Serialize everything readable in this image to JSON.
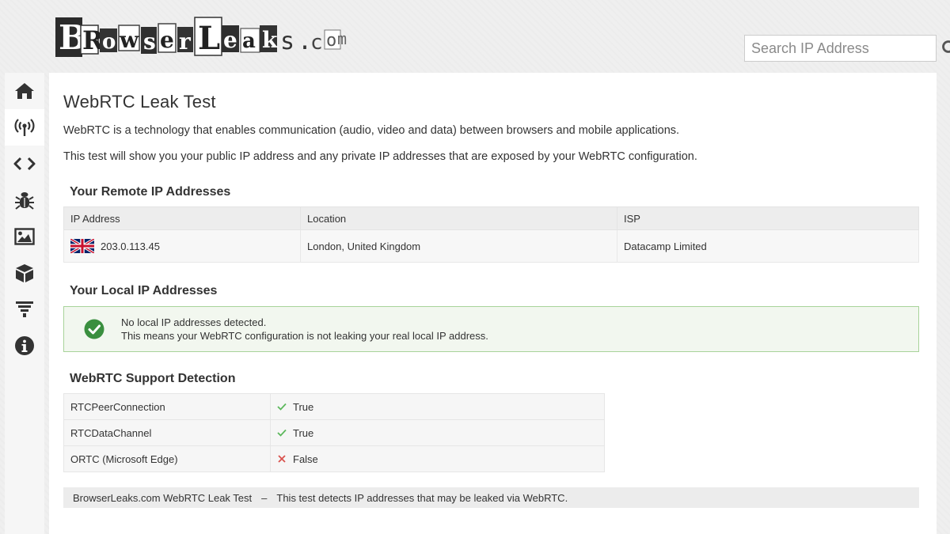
{
  "logo": {
    "text": "BrowserLeaks.com"
  },
  "search": {
    "placeholder": "Search IP Address"
  },
  "sidebar": {
    "items": [
      {
        "icon": "home-icon"
      },
      {
        "icon": "broadcast-tower-icon"
      },
      {
        "icon": "code-icon"
      },
      {
        "icon": "bug-icon"
      },
      {
        "icon": "image-icon"
      },
      {
        "icon": "cube-icon"
      },
      {
        "icon": "filter-icon"
      },
      {
        "icon": "info-icon"
      }
    ]
  },
  "page": {
    "title": "WebRTC Leak Test",
    "intro1": "WebRTC is a technology that enables communication (audio, video and data) between browsers and mobile applications.",
    "intro2": "This test will show you your public IP address and any private IP addresses that are exposed by your WebRTC configuration."
  },
  "remote": {
    "heading": "Your Remote IP Addresses",
    "columns": [
      "IP Address",
      "Location",
      "ISP"
    ],
    "rows": [
      {
        "ip": "203.0.113.45",
        "location": "London, United Kingdom",
        "isp": "Datacamp Limited",
        "flag": "uk-flag-icon"
      }
    ]
  },
  "local": {
    "heading": "Your Local IP Addresses",
    "line1": "No local IP addresses detected.",
    "line2": "This means your WebRTC configuration is not leaking your real local IP address."
  },
  "support": {
    "heading": "WebRTC Support Detection",
    "rows": [
      {
        "key": "RTCPeerConnection",
        "value": "True",
        "status": "ok"
      },
      {
        "key": "RTCDataChannel",
        "value": "True",
        "status": "ok"
      },
      {
        "key": "ORTC (Microsoft Edge)",
        "value": "False",
        "status": "fail"
      }
    ]
  },
  "footer": {
    "title": "BrowserLeaks.com WebRTC Leak Test",
    "separator": "–",
    "text": "This test detects IP addresses that may be leaked via WebRTC."
  },
  "colors": {
    "ok": "#5cb85c",
    "fail": "#d9534f",
    "success_icon": "#3a8f3f"
  }
}
